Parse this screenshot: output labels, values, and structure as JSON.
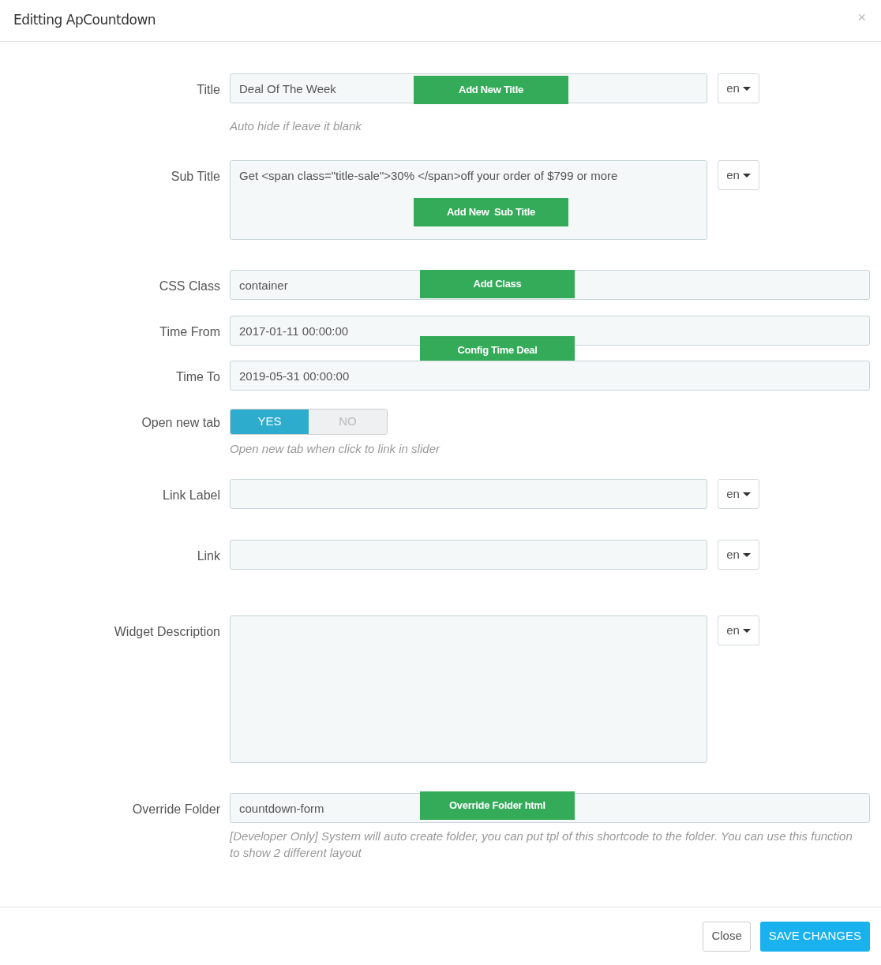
{
  "modal": {
    "title": "Editting ApCountdown",
    "close": "×"
  },
  "fields": [
    {
      "kind": "text",
      "label": "Title",
      "value": "Deal Of The Week",
      "lang": "en",
      "annotation": "Add New Title",
      "help": "Auto hide if leave it blank"
    },
    {
      "kind": "textarea",
      "label": "Sub Title",
      "value": "Get <span class=\"title-sale\">30% </span>off your order of $799 or more",
      "lang": "en",
      "annotation": "Add New  Sub Title"
    },
    {
      "kind": "text",
      "label": "CSS Class",
      "value": "container",
      "annotation": "Add Class"
    },
    {
      "kind": "text",
      "label": "Time From",
      "value": "2017-01-11 00:00:00",
      "annotation": "Config Time Deal"
    },
    {
      "kind": "text",
      "label": "Time To",
      "value": "2019-05-31 00:00:00"
    },
    {
      "kind": "toggle",
      "label": "Open new tab",
      "options": [
        {
          "label": "YES",
          "selected": true
        },
        {
          "label": "NO",
          "selected": false
        }
      ],
      "help": "Open new tab when click to link in slider"
    },
    {
      "kind": "text",
      "label": "Link Label",
      "lang": "en"
    },
    {
      "kind": "text",
      "label": "Link",
      "lang": "en"
    },
    {
      "kind": "bigtext",
      "label": "Widget Description",
      "lang": "en"
    },
    {
      "kind": "text",
      "label": "Override Folder",
      "value": "countdown-form",
      "annotation": "Override Folder html",
      "help": "[Developer Only] System will auto create folder, you can put tpl of this shortcode to the folder. You can use this function to show 2 different layout"
    }
  ],
  "footer": {
    "close": "Close",
    "save": "SAVE CHANGES"
  }
}
